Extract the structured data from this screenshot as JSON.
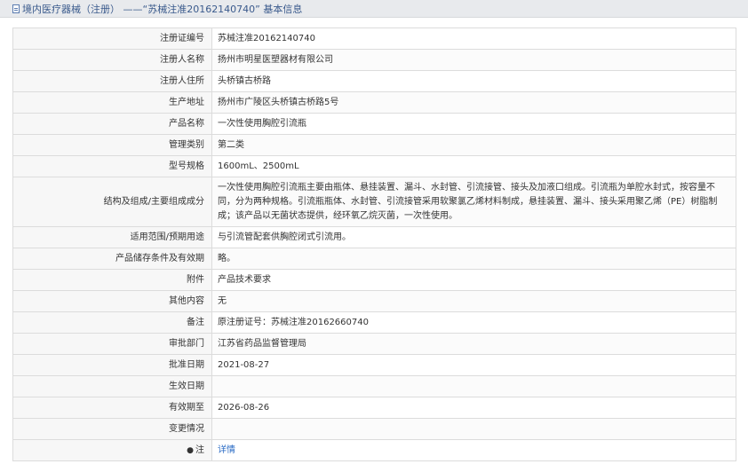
{
  "header": {
    "title": "境内医疗器械（注册） ——“苏械注准20162140740” 基本信息"
  },
  "rows": [
    {
      "label": "注册证编号",
      "value": "苏械注准20162140740"
    },
    {
      "label": "注册人名称",
      "value": "扬州市明星医塑器材有限公司"
    },
    {
      "label": "注册人住所",
      "value": "头桥镇古桥路"
    },
    {
      "label": "生产地址",
      "value": "扬州市广陵区头桥镇古桥路5号"
    },
    {
      "label": "产品名称",
      "value": "一次性使用胸腔引流瓶"
    },
    {
      "label": "管理类别",
      "value": "第二类"
    },
    {
      "label": "型号规格",
      "value": "1600mL、2500mL"
    },
    {
      "label": "结构及组成/主要组成成分",
      "value": "一次性使用胸腔引流瓶主要由瓶体、悬挂装置、漏斗、水封管、引流接管、接头及加液口组成。引流瓶为单腔水封式，按容量不同，分为两种规格。引流瓶瓶体、水封管、引流接管采用软聚氯乙烯材料制成，悬挂装置、漏斗、接头采用聚乙烯（PE）树脂制成；该产品以无菌状态提供，经环氧乙烷灭菌，一次性使用。"
    },
    {
      "label": "适用范围/预期用途",
      "value": "与引流管配套供胸腔闭式引流用。"
    },
    {
      "label": "产品储存条件及有效期",
      "value": "略。"
    },
    {
      "label": "附件",
      "value": "产品技术要求"
    },
    {
      "label": "其他内容",
      "value": "无"
    },
    {
      "label": "备注",
      "value": "原注册证号：苏械注准20162660740"
    },
    {
      "label": "审批部门",
      "value": "江苏省药品监督管理局"
    },
    {
      "label": "批准日期",
      "value": "2021-08-27"
    },
    {
      "label": "生效日期",
      "value": ""
    },
    {
      "label": "有效期至",
      "value": "2026-08-26"
    },
    {
      "label": "变更情况",
      "value": ""
    },
    {
      "label": "注",
      "value": "详情"
    }
  ]
}
